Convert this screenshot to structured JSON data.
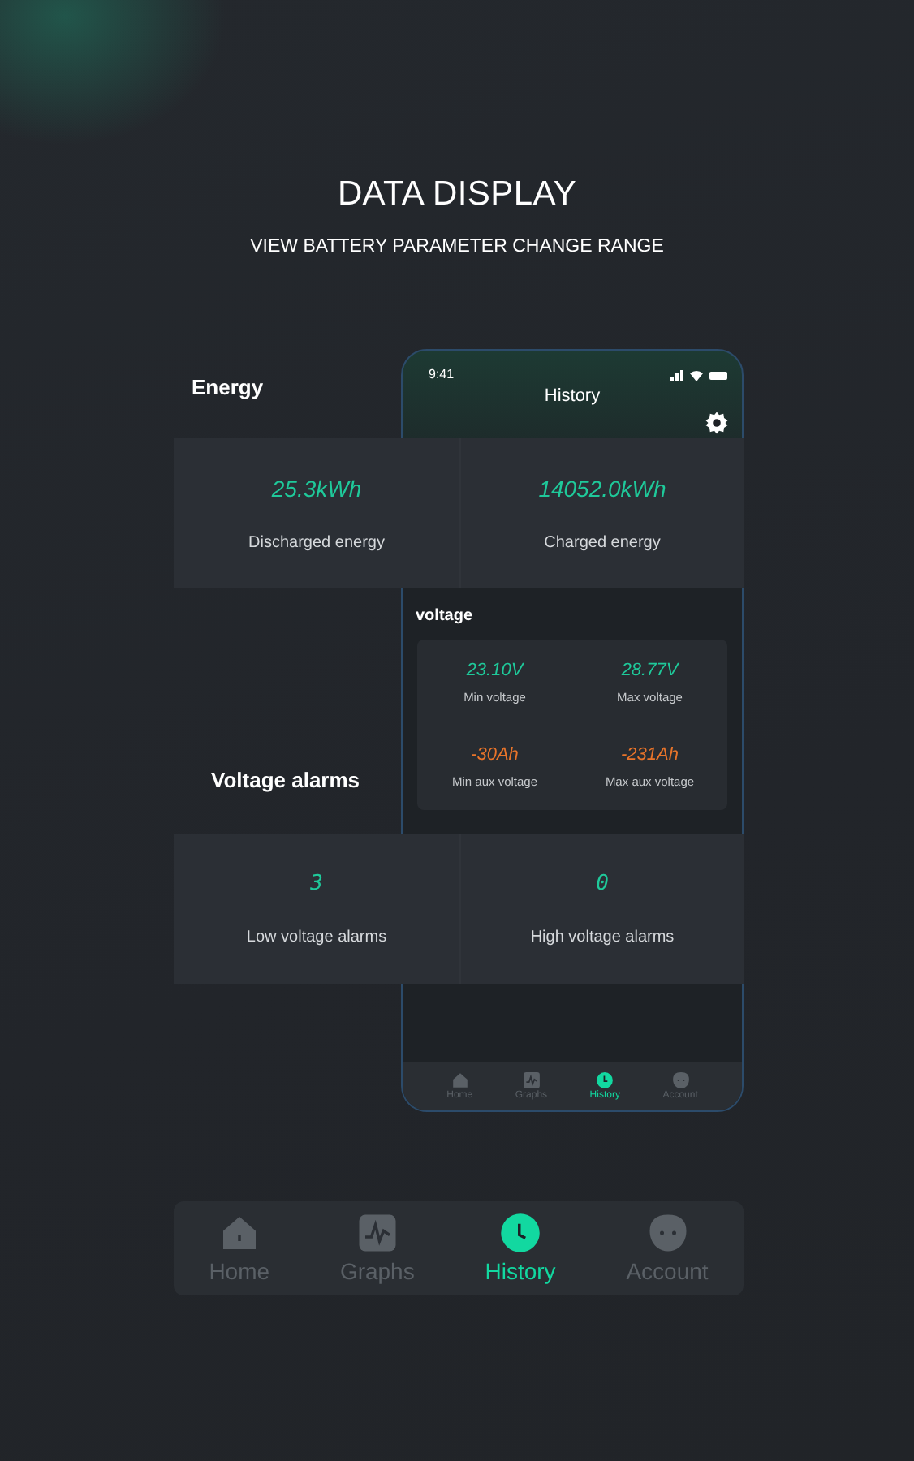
{
  "headline": "DATA DISPLAY",
  "subtitle": "VIEW BATTERY PARAMETER CHANGE RANGE",
  "phone": {
    "time": "9:41",
    "title": "History",
    "section_title": "voltage",
    "stats": [
      {
        "value": "23.10V",
        "label": "Min voltage",
        "color": "#1fc99a"
      },
      {
        "value": "28.77V",
        "label": "Max voltage",
        "color": "#1fc99a"
      },
      {
        "value": "-30Ah",
        "label": "Min aux voltage",
        "color": "#e8742a"
      },
      {
        "value": "-231Ah",
        "label": "Max aux voltage",
        "color": "#e8742a"
      }
    ],
    "tabs": [
      {
        "label": "Home",
        "kind": "home",
        "selected": false
      },
      {
        "label": "Graphs",
        "kind": "graphs",
        "selected": false
      },
      {
        "label": "History",
        "kind": "history",
        "selected": true
      },
      {
        "label": "Account",
        "kind": "account",
        "selected": false
      }
    ]
  },
  "energy": {
    "title": "Energy",
    "stats": [
      {
        "value": "25.3kWh",
        "label": "Discharged energy"
      },
      {
        "value": "14052.0kWh",
        "label": "Charged energy"
      }
    ]
  },
  "alarms": {
    "title": "Voltage alarms",
    "stats": [
      {
        "value": "3",
        "label": "Low voltage alarms"
      },
      {
        "value": "0",
        "label": "High voltage alarms"
      }
    ]
  },
  "nav": {
    "tabs": [
      {
        "label": "Home",
        "kind": "home",
        "selected": false
      },
      {
        "label": "Graphs",
        "kind": "graphs",
        "selected": false
      },
      {
        "label": "History",
        "kind": "history",
        "selected": true
      },
      {
        "label": "Account",
        "kind": "account",
        "selected": false
      }
    ]
  }
}
